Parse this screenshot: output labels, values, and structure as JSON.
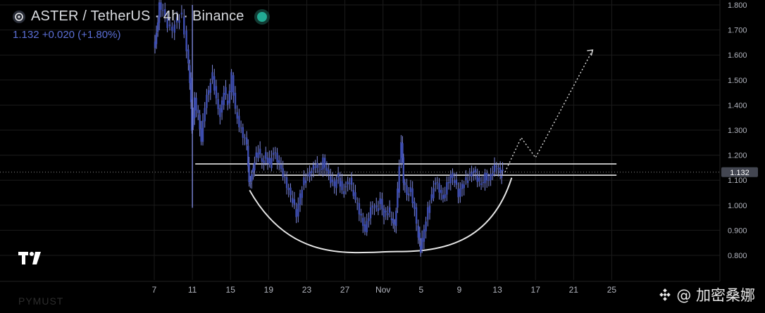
{
  "header": {
    "title": "ASTER / TetherUS · 4h · Binance",
    "quote": "1.132 +0.020 (+1.80%)"
  },
  "colors": {
    "background": "#000000",
    "candle": "#3f4fb3",
    "wick": "#7d87d9",
    "grid": "#1b1b1b",
    "neckline": "#e6e6e6",
    "last_price_label_bg": "#434651",
    "status_dot": "#22ab94"
  },
  "icons": [
    "aster-logo-icon",
    "status-dot-icon",
    "tradingview-logo-icon",
    "binance-diamond-icon"
  ],
  "watermark": "@ 加密桑娜",
  "bottom_faint_text": "PYMUST",
  "chart_data": {
    "type": "candlestick",
    "title": "ASTER / TetherUS · 4h · Binance",
    "xlabel": "",
    "ylabel": "",
    "y_axis_position": "right",
    "ylim": [
      0.78,
      1.8
    ],
    "yticks": [
      "1.800",
      "1.700",
      "1.600",
      "1.500",
      "1.400",
      "1.300",
      "1.200",
      "1.100",
      "1.000",
      "0.900",
      "0.800"
    ],
    "ytick_values": [
      1.8,
      1.7,
      1.6,
      1.5,
      1.4,
      1.3,
      1.2,
      1.1,
      1.0,
      0.9,
      0.8
    ],
    "x_range_day": [
      4.0,
      28.5
    ],
    "xticks": [
      {
        "label": "7",
        "day": 7
      },
      {
        "label": "11",
        "day": 11
      },
      {
        "label": "15",
        "day": 15
      },
      {
        "label": "19",
        "day": 19
      },
      {
        "label": "23",
        "day": 23
      },
      {
        "label": "27",
        "day": 27
      },
      {
        "label": "Nov",
        "day": 31
      },
      {
        "label": "5",
        "day": 35
      },
      {
        "label": "9",
        "day": 39
      },
      {
        "label": "13",
        "day": 43
      },
      {
        "label": "17",
        "day": 47
      },
      {
        "label": "21",
        "day": 51
      },
      {
        "label": "25",
        "day": 55
      }
    ],
    "last_price": 1.132,
    "last_price_label": "1.132",
    "grid": true,
    "price_path": [
      [
        7.0,
        1.62
      ],
      [
        7.3,
        1.68
      ],
      [
        7.6,
        1.8
      ],
      [
        8.0,
        1.78
      ],
      [
        8.5,
        1.72
      ],
      [
        9.0,
        1.7
      ],
      [
        9.5,
        1.74
      ],
      [
        10.0,
        1.76
      ],
      [
        10.5,
        1.62
      ],
      [
        10.8,
        1.5
      ],
      [
        11.0,
        1.3
      ],
      [
        11.3,
        1.42
      ],
      [
        11.7,
        1.36
      ],
      [
        12.0,
        1.26
      ],
      [
        12.4,
        1.4
      ],
      [
        12.8,
        1.46
      ],
      [
        13.2,
        1.52
      ],
      [
        13.6,
        1.42
      ],
      [
        14.0,
        1.36
      ],
      [
        14.4,
        1.46
      ],
      [
        14.8,
        1.4
      ],
      [
        15.2,
        1.52
      ],
      [
        15.6,
        1.38
      ],
      [
        16.0,
        1.32
      ],
      [
        16.4,
        1.28
      ],
      [
        16.8,
        1.24
      ],
      [
        17.0,
        1.08
      ],
      [
        17.3,
        1.12
      ],
      [
        17.6,
        1.18
      ],
      [
        18.0,
        1.22
      ],
      [
        18.4,
        1.17
      ],
      [
        18.8,
        1.2
      ],
      [
        19.2,
        1.16
      ],
      [
        19.6,
        1.22
      ],
      [
        20.0,
        1.18
      ],
      [
        20.4,
        1.14
      ],
      [
        20.8,
        1.1
      ],
      [
        21.2,
        1.06
      ],
      [
        21.6,
        1.02
      ],
      [
        22.0,
        0.96
      ],
      [
        22.4,
        1.04
      ],
      [
        22.8,
        1.1
      ],
      [
        23.2,
        1.12
      ],
      [
        23.6,
        1.14
      ],
      [
        24.0,
        1.16
      ],
      [
        24.4,
        1.13
      ],
      [
        24.8,
        1.18
      ],
      [
        25.2,
        1.14
      ],
      [
        25.6,
        1.1
      ],
      [
        26.0,
        1.08
      ],
      [
        26.4,
        1.12
      ],
      [
        26.8,
        1.05
      ],
      [
        27.2,
        1.08
      ],
      [
        27.6,
        1.1
      ],
      [
        28.0,
        1.04
      ],
      [
        28.4,
        1.0
      ],
      [
        28.8,
        0.95
      ],
      [
        29.2,
        0.9
      ],
      [
        29.6,
        0.96
      ],
      [
        30.0,
        1.0
      ],
      [
        30.4,
        0.98
      ],
      [
        30.8,
        1.02
      ],
      [
        31.2,
        0.96
      ],
      [
        31.6,
        0.98
      ],
      [
        32.0,
        0.94
      ],
      [
        32.3,
        0.92
      ],
      [
        32.6,
        1.06
      ],
      [
        33.0,
        1.26
      ],
      [
        33.2,
        1.1
      ],
      [
        33.6,
        1.04
      ],
      [
        34.0,
        1.06
      ],
      [
        34.4,
        0.98
      ],
      [
        34.8,
        0.88
      ],
      [
        35.0,
        0.82
      ],
      [
        35.4,
        0.9
      ],
      [
        35.8,
        0.98
      ],
      [
        36.2,
        1.04
      ],
      [
        36.6,
        1.1
      ],
      [
        37.0,
        1.06
      ],
      [
        37.4,
        1.02
      ],
      [
        37.8,
        1.08
      ],
      [
        38.2,
        1.12
      ],
      [
        38.6,
        1.1
      ],
      [
        39.0,
        1.04
      ],
      [
        39.4,
        1.08
      ],
      [
        39.8,
        1.1
      ],
      [
        40.2,
        1.12
      ],
      [
        40.6,
        1.14
      ],
      [
        41.0,
        1.1
      ],
      [
        41.4,
        1.08
      ],
      [
        41.8,
        1.12
      ],
      [
        42.2,
        1.1
      ],
      [
        42.6,
        1.14
      ],
      [
        43.0,
        1.16
      ],
      [
        43.4,
        1.12
      ],
      [
        43.6,
        1.132
      ]
    ],
    "annotations": {
      "neckline_upper": {
        "y": 1.165,
        "x_start": 11.3,
        "x_end": 55.5
      },
      "neckline_lower": {
        "y": 1.12,
        "x_start": 17.5,
        "x_end": 55.5
      },
      "cup_curve": {
        "x_start": 17.0,
        "y_start": 1.06,
        "x_bottom": 32.5,
        "y_bottom": 0.815,
        "x_end": 44.5,
        "y_end": 1.11
      },
      "projection": [
        [
          43.8,
          1.132
        ],
        [
          45.5,
          1.27
        ],
        [
          47.0,
          1.19
        ],
        [
          53.0,
          1.62
        ]
      ]
    }
  }
}
